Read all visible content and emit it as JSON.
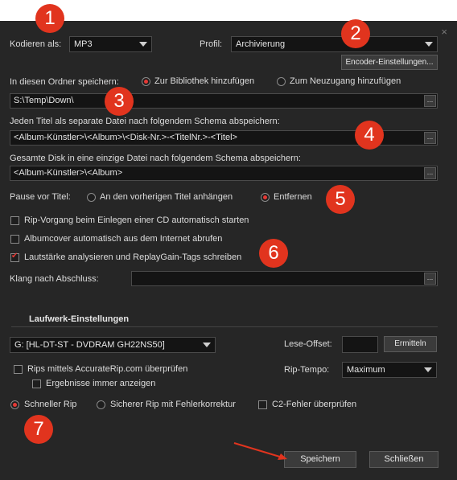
{
  "window": {
    "close_glyph": "×"
  },
  "encoder": {
    "label": "Kodieren als:",
    "value": "MP3",
    "profile_label": "Profil:",
    "profile_value": "Archivierung",
    "settings_button": "Encoder-Einstellungen..."
  },
  "save_folder": {
    "label": "In diesen Ordner speichern:",
    "option_library": "Zur Bibliothek hinzufügen",
    "option_new": "Zum Neuzugang hinzufügen",
    "path": "S:\\Temp\\Down\\"
  },
  "separate_files": {
    "label": "Jeden Titel als separate Datei nach folgendem Schema abspeichern:",
    "schema": "<Album-Künstler>\\<Album>\\<Disk-Nr.>-<TitelNr.>-<Titel>"
  },
  "single_file": {
    "label": "Gesamte Disk in eine einzige Datei nach folgendem Schema abspeichern:",
    "schema": "<Album-Künstler>\\<Album>"
  },
  "pause": {
    "label": "Pause vor Titel:",
    "option_append": "An den vorherigen Titel anhängen",
    "option_remove": "Entfernen"
  },
  "options": {
    "autostart": "Rip-Vorgang beim Einlegen einer CD automatisch starten",
    "cover": "Albumcover automatisch aus dem Internet abrufen",
    "replaygain": "Lautstärke analysieren und ReplayGain-Tags schreiben"
  },
  "sound": {
    "label": "Klang nach Abschluss:",
    "value": ""
  },
  "drive": {
    "section_title": "Laufwerk-Einstellungen",
    "drive_value": "G: [HL-DT-ST - DVDRAM GH22NS50]",
    "offset_label": "Lese-Offset:",
    "offset_value": "",
    "detect_button": "Ermitteln",
    "accuraterip": "Rips mittels AccurateRip.com überprüfen",
    "show_results": "Ergebnisse immer anzeigen",
    "speed_label": "Rip-Tempo:",
    "speed_value": "Maximum"
  },
  "rip_mode": {
    "fast": "Schneller Rip",
    "secure": "Sicherer Rip mit Fehlerkorrektur",
    "c2": "C2-Fehler überprüfen"
  },
  "footer": {
    "save": "Speichern",
    "close": "Schließen"
  },
  "markers": [
    "1",
    "2",
    "3",
    "4",
    "5",
    "6",
    "7"
  ],
  "colors": {
    "accent": "#e53935",
    "badge": "#e1341e",
    "background": "#262626"
  }
}
